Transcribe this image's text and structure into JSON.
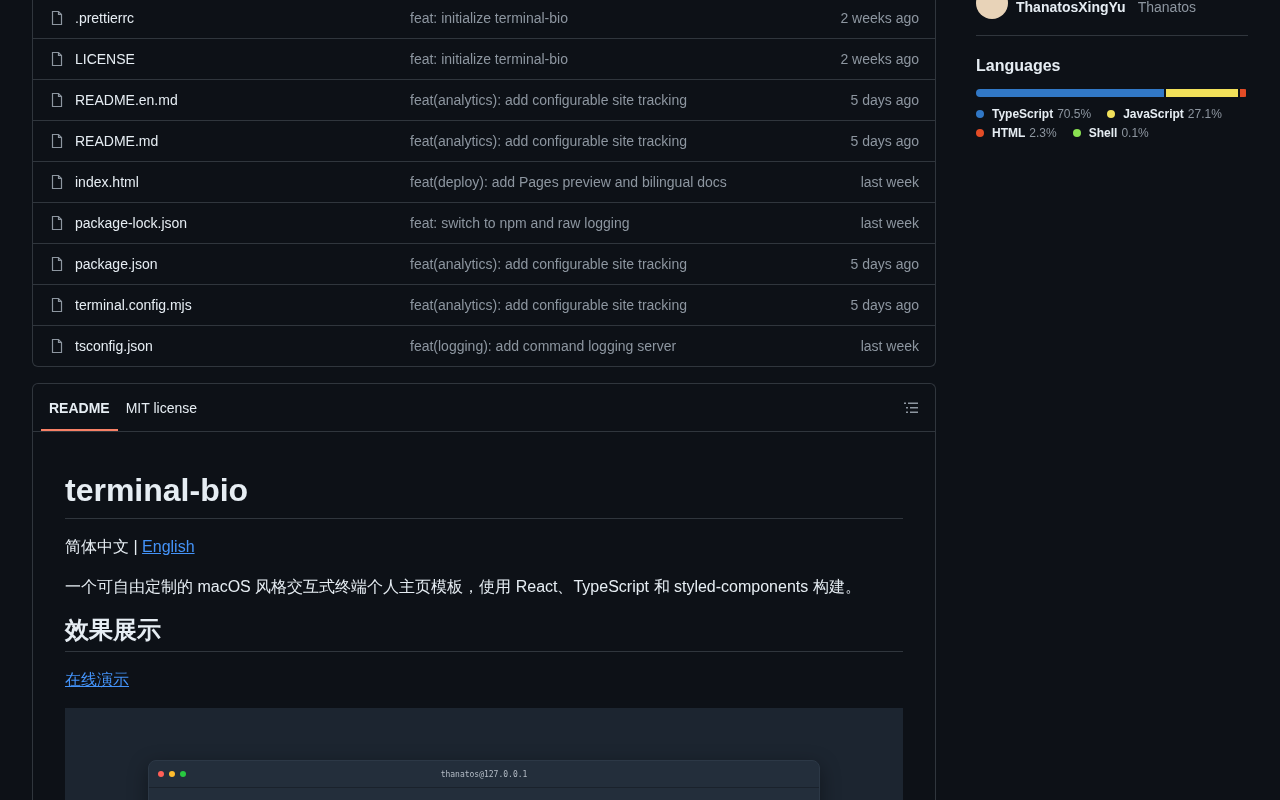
{
  "files": [
    {
      "name": ".prettierrc",
      "message": "feat: initialize terminal-bio",
      "time": "2 weeks ago"
    },
    {
      "name": "LICENSE",
      "message": "feat: initialize terminal-bio",
      "time": "2 weeks ago"
    },
    {
      "name": "README.en.md",
      "message": "feat(analytics): add configurable site tracking",
      "time": "5 days ago"
    },
    {
      "name": "README.md",
      "message": "feat(analytics): add configurable site tracking",
      "time": "5 days ago"
    },
    {
      "name": "index.html",
      "message": "feat(deploy): add Pages preview and bilingual docs",
      "time": "last week"
    },
    {
      "name": "package-lock.json",
      "message": "feat: switch to npm and raw logging",
      "time": "last week"
    },
    {
      "name": "package.json",
      "message": "feat(analytics): add configurable site tracking",
      "time": "5 days ago"
    },
    {
      "name": "terminal.config.mjs",
      "message": "feat(analytics): add configurable site tracking",
      "time": "5 days ago"
    },
    {
      "name": "tsconfig.json",
      "message": "feat(logging): add command logging server",
      "time": "last week"
    }
  ],
  "readme": {
    "tabs": [
      {
        "label": "README",
        "selected": true
      },
      {
        "label": "MIT license",
        "selected": false
      }
    ],
    "title": "terminal-bio",
    "lang_current": "简体中文 |",
    "lang_link": "English",
    "description": "一个可自由定制的 macOS 风格交互式终端个人主页模板，使用 React、TypeScript 和 styled-components 构建。",
    "heading": "效果展示",
    "demo_link": "在线演示",
    "terminal_title": "thanatos@127.0.0.1"
  },
  "sidebar": {
    "contributor": {
      "login": "ThanatosXingYu",
      "name": "Thanatos"
    },
    "languages_title": "Languages",
    "languages": [
      {
        "name": "TypeScript",
        "percent": "70.5%",
        "color": "#3178c6"
      },
      {
        "name": "JavaScript",
        "percent": "27.1%",
        "color": "#f1e05a"
      },
      {
        "name": "HTML",
        "percent": "2.3%",
        "color": "#e34c26"
      },
      {
        "name": "Shell",
        "percent": "0.1%",
        "color": "#89e051"
      }
    ]
  }
}
